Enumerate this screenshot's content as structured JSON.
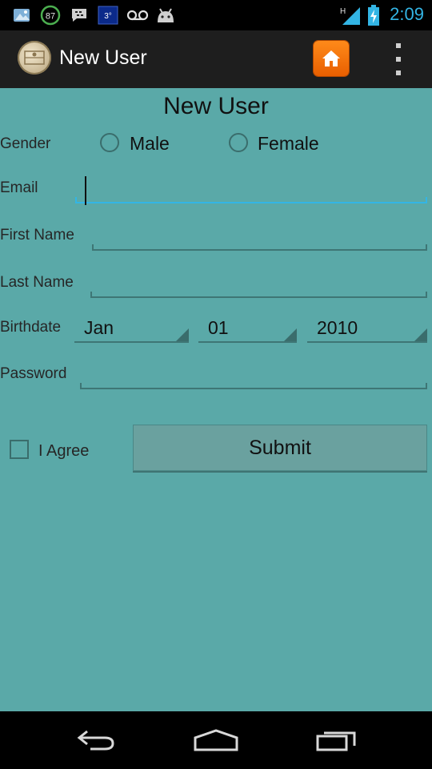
{
  "status_bar": {
    "time": "2:09",
    "battery_percent_badge": "87",
    "calendar_badge": "3°",
    "network_type": "H",
    "icons": [
      "notification-icon",
      "battery-percent-icon",
      "blackberry-messenger-icon",
      "calendar-icon",
      "voicemail-icon",
      "android-icon",
      "signal-icon",
      "battery-charging-icon"
    ]
  },
  "action_bar": {
    "title": "New User",
    "icons": [
      "app-logo-icon",
      "home-icon",
      "overflow-menu-icon"
    ]
  },
  "form": {
    "title": "New User",
    "gender": {
      "label": "Gender",
      "options": [
        "Male",
        "Female"
      ]
    },
    "email": {
      "label": "Email",
      "value": ""
    },
    "first_name": {
      "label": "First Name",
      "value": ""
    },
    "last_name": {
      "label": "Last Name",
      "value": ""
    },
    "birthdate": {
      "label": "Birthdate",
      "month": "Jan",
      "day": "01",
      "year": "2010"
    },
    "password": {
      "label": "Password",
      "value": ""
    },
    "agree": {
      "label": "I Agree",
      "checked": false
    },
    "submit_label": "Submit"
  },
  "nav_bar": {
    "icons": [
      "back-icon",
      "home-nav-icon",
      "recent-apps-icon"
    ]
  },
  "colors": {
    "background": "#5aa9a8",
    "accent": "#33b5e5",
    "home_button": "#f57c00"
  }
}
